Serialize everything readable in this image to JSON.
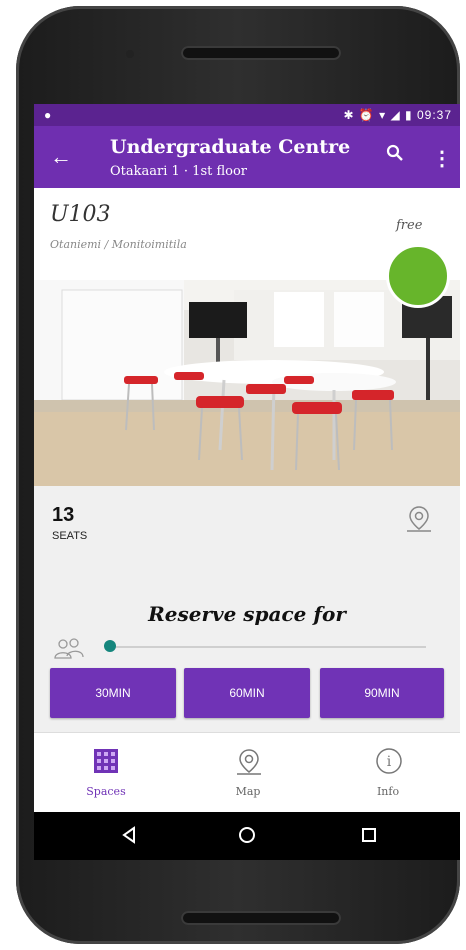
{
  "status_bar": {
    "time": "09:37",
    "icons": "✱ ⏰ ▾ ◢ ▮"
  },
  "app_bar": {
    "title": "Undergraduate Centre",
    "subtitle": "Otakaari 1 · 1st floor"
  },
  "room": {
    "code": "U103",
    "location": "Otaniemi / Monitoimitila",
    "status": "free",
    "status_color": "#67b52b"
  },
  "seats": {
    "count": "13",
    "label": "SEATS"
  },
  "reserve": {
    "heading": "Reserve space for",
    "buttons": [
      "30MIN",
      "60MIN",
      "90MIN"
    ]
  },
  "bottom_nav": [
    {
      "label": "Spaces",
      "active": true
    },
    {
      "label": "Map",
      "active": false
    },
    {
      "label": "Info",
      "active": false
    }
  ],
  "icons": [
    "back-arrow-icon",
    "search-icon",
    "more-vert-icon",
    "location-pin-icon",
    "people-icon",
    "spaces-grid-icon",
    "map-pin-icon",
    "info-icon",
    "nav-back-icon",
    "nav-home-icon",
    "nav-recents-icon"
  ],
  "colors": {
    "primary": "#6f2fb0",
    "status_bar": "#5b2390",
    "accent": "#15867d",
    "free": "#67b52b"
  }
}
